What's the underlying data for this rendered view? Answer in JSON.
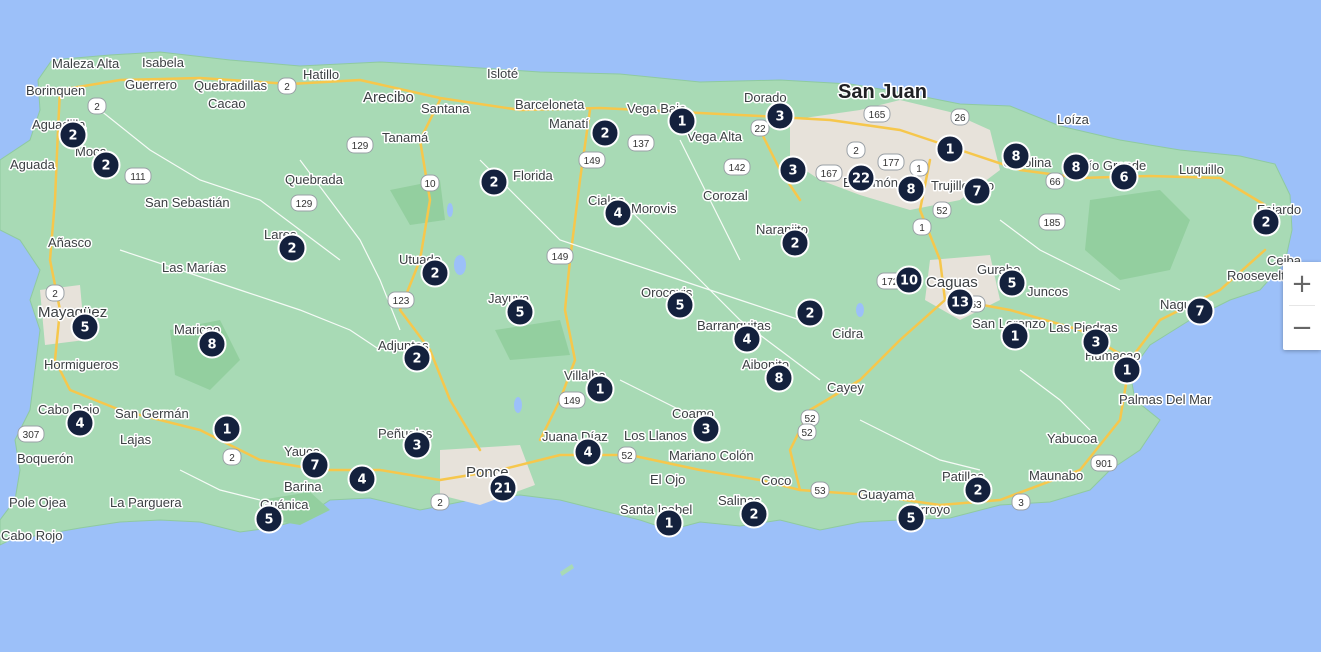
{
  "map": {
    "places": [
      {
        "name": "San Juan",
        "cls": "major"
      },
      {
        "name": "Maleza Alta"
      },
      {
        "name": "Isabela"
      },
      {
        "name": "Borinquen"
      },
      {
        "name": "Guerrero"
      },
      {
        "name": "Quebradillas"
      },
      {
        "name": "Hatillo"
      },
      {
        "name": "Isloté"
      },
      {
        "name": "Cacao"
      },
      {
        "name": "Arecibo",
        "cls": "med"
      },
      {
        "name": "Santana"
      },
      {
        "name": "Barceloneta"
      },
      {
        "name": "Vega Baja"
      },
      {
        "name": "Dorado"
      },
      {
        "name": "Loíza"
      },
      {
        "name": "Aguadilla"
      },
      {
        "name": "Tanamá"
      },
      {
        "name": "Manatí"
      },
      {
        "name": "Vega Alta"
      },
      {
        "name": "Aguada"
      },
      {
        "name": "Moca"
      },
      {
        "name": "Florida"
      },
      {
        "name": "Quebrada"
      },
      {
        "name": "Carolina"
      },
      {
        "name": "Río Grande"
      },
      {
        "name": "Luquillo"
      },
      {
        "name": "San Sebastián"
      },
      {
        "name": "Ciales"
      },
      {
        "name": "Morovis"
      },
      {
        "name": "Corozal"
      },
      {
        "name": "Bayamón"
      },
      {
        "name": "Trujillo Alto"
      },
      {
        "name": "Fajardo"
      },
      {
        "name": "Añasco"
      },
      {
        "name": "Lares"
      },
      {
        "name": "Naranjito"
      },
      {
        "name": "Las Marías"
      },
      {
        "name": "Utuado"
      },
      {
        "name": "Gurabo"
      },
      {
        "name": "Caguas",
        "cls": "med"
      },
      {
        "name": "Ceiba"
      },
      {
        "name": "Roosevelt Roads"
      },
      {
        "name": "Jayuya"
      },
      {
        "name": "Juncos"
      },
      {
        "name": "Orocovis"
      },
      {
        "name": "Mayagüez",
        "cls": "med"
      },
      {
        "name": "Naguabo"
      },
      {
        "name": "Maricao"
      },
      {
        "name": "Adjuntas"
      },
      {
        "name": "Barranquitas"
      },
      {
        "name": "Cidra"
      },
      {
        "name": "San Lorenzo"
      },
      {
        "name": "Las Piedras"
      },
      {
        "name": "Humacao"
      },
      {
        "name": "Hormigueros"
      },
      {
        "name": "Aibonito"
      },
      {
        "name": "Villalba"
      },
      {
        "name": "Cayey"
      },
      {
        "name": "Cabo Rojo"
      },
      {
        "name": "San Germán"
      },
      {
        "name": "Palmas Del Mar"
      },
      {
        "name": "Lajas"
      },
      {
        "name": "Coamo"
      },
      {
        "name": "Peñuelas"
      },
      {
        "name": "Juana Díaz"
      },
      {
        "name": "Los Llanos"
      },
      {
        "name": "Yabucoa"
      },
      {
        "name": "Boquerón"
      },
      {
        "name": "Yauco"
      },
      {
        "name": "Mariano Colón"
      },
      {
        "name": "Ponce",
        "cls": "med"
      },
      {
        "name": "Patillas"
      },
      {
        "name": "Maunabo"
      },
      {
        "name": "Barina"
      },
      {
        "name": "El Ojo"
      },
      {
        "name": "Coco"
      },
      {
        "name": "Pole Ojea"
      },
      {
        "name": "La Parguera"
      },
      {
        "name": "Guánica"
      },
      {
        "name": "Guayama"
      },
      {
        "name": "Santa Isabel"
      },
      {
        "name": "Salinas"
      },
      {
        "name": "Arroyo"
      },
      {
        "name": "Cabo Rojo"
      }
    ],
    "shields": [
      "2",
      "2",
      "165",
      "26",
      "129",
      "10",
      "149",
      "137",
      "142",
      "22",
      "2",
      "177",
      "167",
      "1",
      "52",
      "1",
      "66",
      "185",
      "111",
      "129",
      "2",
      "123",
      "149",
      "172",
      "53",
      "307",
      "2",
      "149",
      "52",
      "52",
      "52",
      "2",
      "53",
      "3",
      "901"
    ],
    "clusters": [
      {
        "count": "2"
      },
      {
        "count": "2"
      },
      {
        "count": "2"
      },
      {
        "count": "3"
      },
      {
        "count": "1"
      },
      {
        "count": "3"
      },
      {
        "count": "1"
      },
      {
        "count": "22"
      },
      {
        "count": "8"
      },
      {
        "count": "7"
      },
      {
        "count": "8"
      },
      {
        "count": "8"
      },
      {
        "count": "6"
      },
      {
        "count": "2"
      },
      {
        "count": "4"
      },
      {
        "count": "2"
      },
      {
        "count": "2"
      },
      {
        "count": "2"
      },
      {
        "count": "2"
      },
      {
        "count": "10"
      },
      {
        "count": "5"
      },
      {
        "count": "5"
      },
      {
        "count": "5"
      },
      {
        "count": "13"
      },
      {
        "count": "5"
      },
      {
        "count": "2"
      },
      {
        "count": "8"
      },
      {
        "count": "2"
      },
      {
        "count": "4"
      },
      {
        "count": "7"
      },
      {
        "count": "1"
      },
      {
        "count": "3"
      },
      {
        "count": "1"
      },
      {
        "count": "1"
      },
      {
        "count": "8"
      },
      {
        "count": "4"
      },
      {
        "count": "3"
      },
      {
        "count": "1"
      },
      {
        "count": "3"
      },
      {
        "count": "4"
      },
      {
        "count": "7"
      },
      {
        "count": "4"
      },
      {
        "count": "21"
      },
      {
        "count": "5"
      },
      {
        "count": "1"
      },
      {
        "count": "2"
      },
      {
        "count": "5"
      },
      {
        "count": "2"
      }
    ]
  },
  "controls": {
    "zoom_in": "+",
    "zoom_out": "−"
  },
  "colors": {
    "water": "#9cc0f9",
    "land": "#a8dab5",
    "cluster": "#14213d",
    "road": "#f6c74c"
  }
}
